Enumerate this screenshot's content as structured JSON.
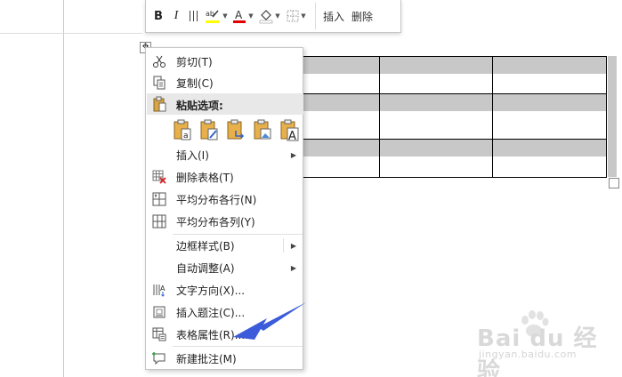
{
  "toolbar": {
    "bold": "B",
    "italic": "I",
    "insert_label": "插入",
    "delete_label": "删除"
  },
  "table_handle_glyph": "✥",
  "menu": {
    "cut": "剪切(T)",
    "copy": "复制(C)",
    "paste_options": "粘贴选项:",
    "insert": "插入(I)",
    "delete_table": "删除表格(T)",
    "distribute_rows": "平均分布各行(N)",
    "distribute_cols": "平均分布各列(Y)",
    "border_styles": "边框样式(B)",
    "autofit": "自动调整(A)",
    "text_direction": "文字方向(X)...",
    "insert_caption": "插入题注(C)...",
    "table_properties": "表格属性(R)...",
    "new_comment": "新建批注(M)"
  },
  "colors": {
    "highlight": "#ffff00",
    "font_color": "#e00000",
    "arrow": "#3b5bdb"
  },
  "watermark": {
    "brand": "Bai du 经验",
    "url": "jingyan.baidu.com"
  }
}
